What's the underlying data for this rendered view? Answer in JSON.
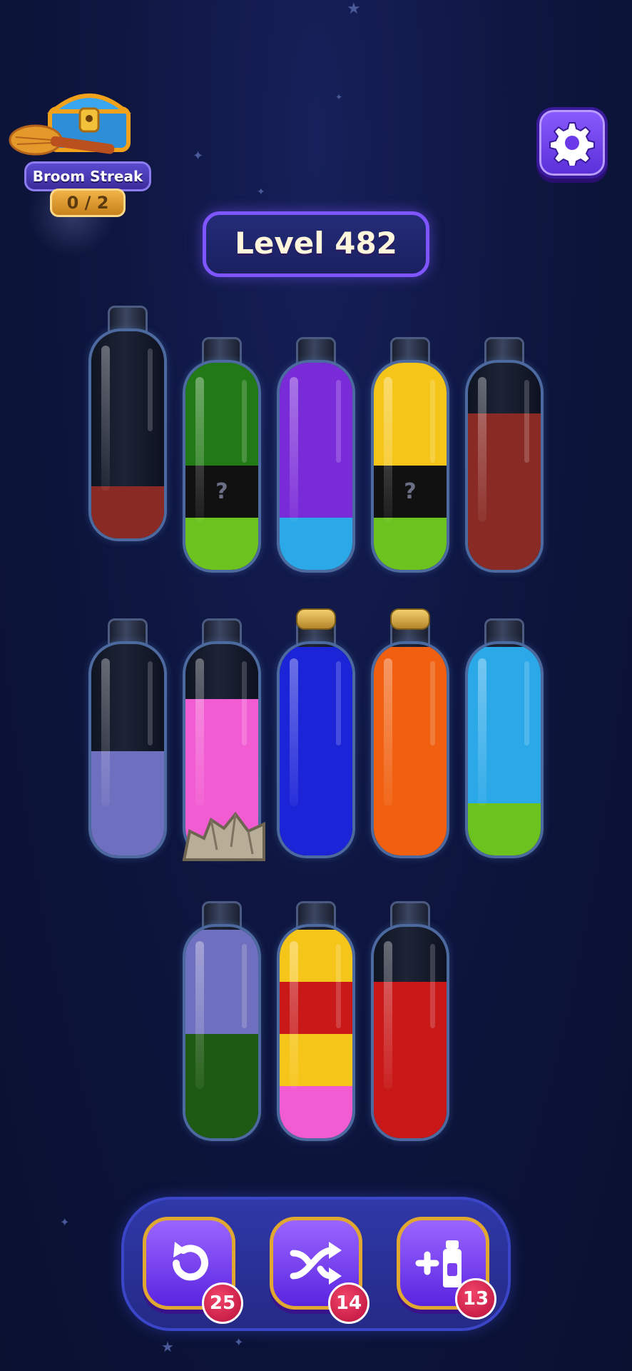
{
  "colors": {
    "background": "#0e1640",
    "accent": "#7e55ff",
    "badge": "#d8204e",
    "boost_border": "#e0a830"
  },
  "streak": {
    "label": "Broom Streak",
    "progress": "0 / 2"
  },
  "level": {
    "label": "Level 482"
  },
  "tubes": [
    {
      "row": 1,
      "corked": false,
      "layers": [
        {
          "color": "#8a2a24"
        }
      ]
    },
    {
      "row": 1,
      "corked": false,
      "layers": [
        {
          "color": "#6cc21f"
        },
        {
          "color": "#111111",
          "mystery": true,
          "label": "?"
        },
        {
          "color": "#227a17"
        },
        {
          "color": "#227a17"
        }
      ]
    },
    {
      "row": 1,
      "corked": false,
      "layers": [
        {
          "color": "#2aa8e8"
        },
        {
          "color": "#7a2bd8"
        },
        {
          "color": "#7a2bd8"
        },
        {
          "color": "#7a2bd8"
        }
      ]
    },
    {
      "row": 1,
      "corked": false,
      "layers": [
        {
          "color": "#6cc21f"
        },
        {
          "color": "#111111",
          "mystery": true,
          "label": "?"
        },
        {
          "color": "#f6c51a"
        },
        {
          "color": "#f6c51a"
        }
      ]
    },
    {
      "row": 1,
      "corked": false,
      "layers": [
        {
          "color": "#8a2a24"
        },
        {
          "color": "#8a2a24"
        },
        {
          "color": "#8a2a24"
        }
      ]
    },
    {
      "row": 2,
      "corked": false,
      "layers": [
        {
          "color": "#6f6fbf"
        },
        {
          "color": "#6f6fbf"
        }
      ]
    },
    {
      "row": 2,
      "corked": false,
      "rocks": true,
      "layers": [
        {
          "color": "#f25cd2"
        },
        {
          "color": "#f25cd2"
        },
        {
          "color": "#f25cd2"
        }
      ]
    },
    {
      "row": 2,
      "corked": true,
      "layers": [
        {
          "color": "#1c24d8"
        },
        {
          "color": "#1c24d8"
        },
        {
          "color": "#1c24d8"
        },
        {
          "color": "#1c24d8"
        }
      ]
    },
    {
      "row": 2,
      "corked": true,
      "layers": [
        {
          "color": "#f06010"
        },
        {
          "color": "#f06010"
        },
        {
          "color": "#f06010"
        },
        {
          "color": "#f06010"
        }
      ]
    },
    {
      "row": 2,
      "corked": false,
      "layers": [
        {
          "color": "#6cc21f"
        },
        {
          "color": "#2aa8e8"
        },
        {
          "color": "#2aa8e8"
        },
        {
          "color": "#2aa8e8"
        }
      ]
    },
    {
      "row": 3,
      "corked": false,
      "layers": [
        {
          "color": "#1f5a14"
        },
        {
          "color": "#1f5a14"
        },
        {
          "color": "#6f6fbf"
        },
        {
          "color": "#6f6fbf"
        }
      ]
    },
    {
      "row": 3,
      "corked": false,
      "layers": [
        {
          "color": "#f25cd2"
        },
        {
          "color": "#f6c51a"
        },
        {
          "color": "#c81818"
        },
        {
          "color": "#f6c51a"
        }
      ]
    },
    {
      "row": 3,
      "corked": false,
      "layers": [
        {
          "color": "#c81818"
        },
        {
          "color": "#c81818"
        },
        {
          "color": "#c81818"
        }
      ]
    }
  ],
  "boosters": [
    {
      "name": "undo",
      "icon": "undo-icon",
      "count": "25"
    },
    {
      "name": "shuffle",
      "icon": "shuffle-icon",
      "count": "14"
    },
    {
      "name": "add-tube",
      "icon": "add-tube-icon",
      "count": "13"
    }
  ]
}
